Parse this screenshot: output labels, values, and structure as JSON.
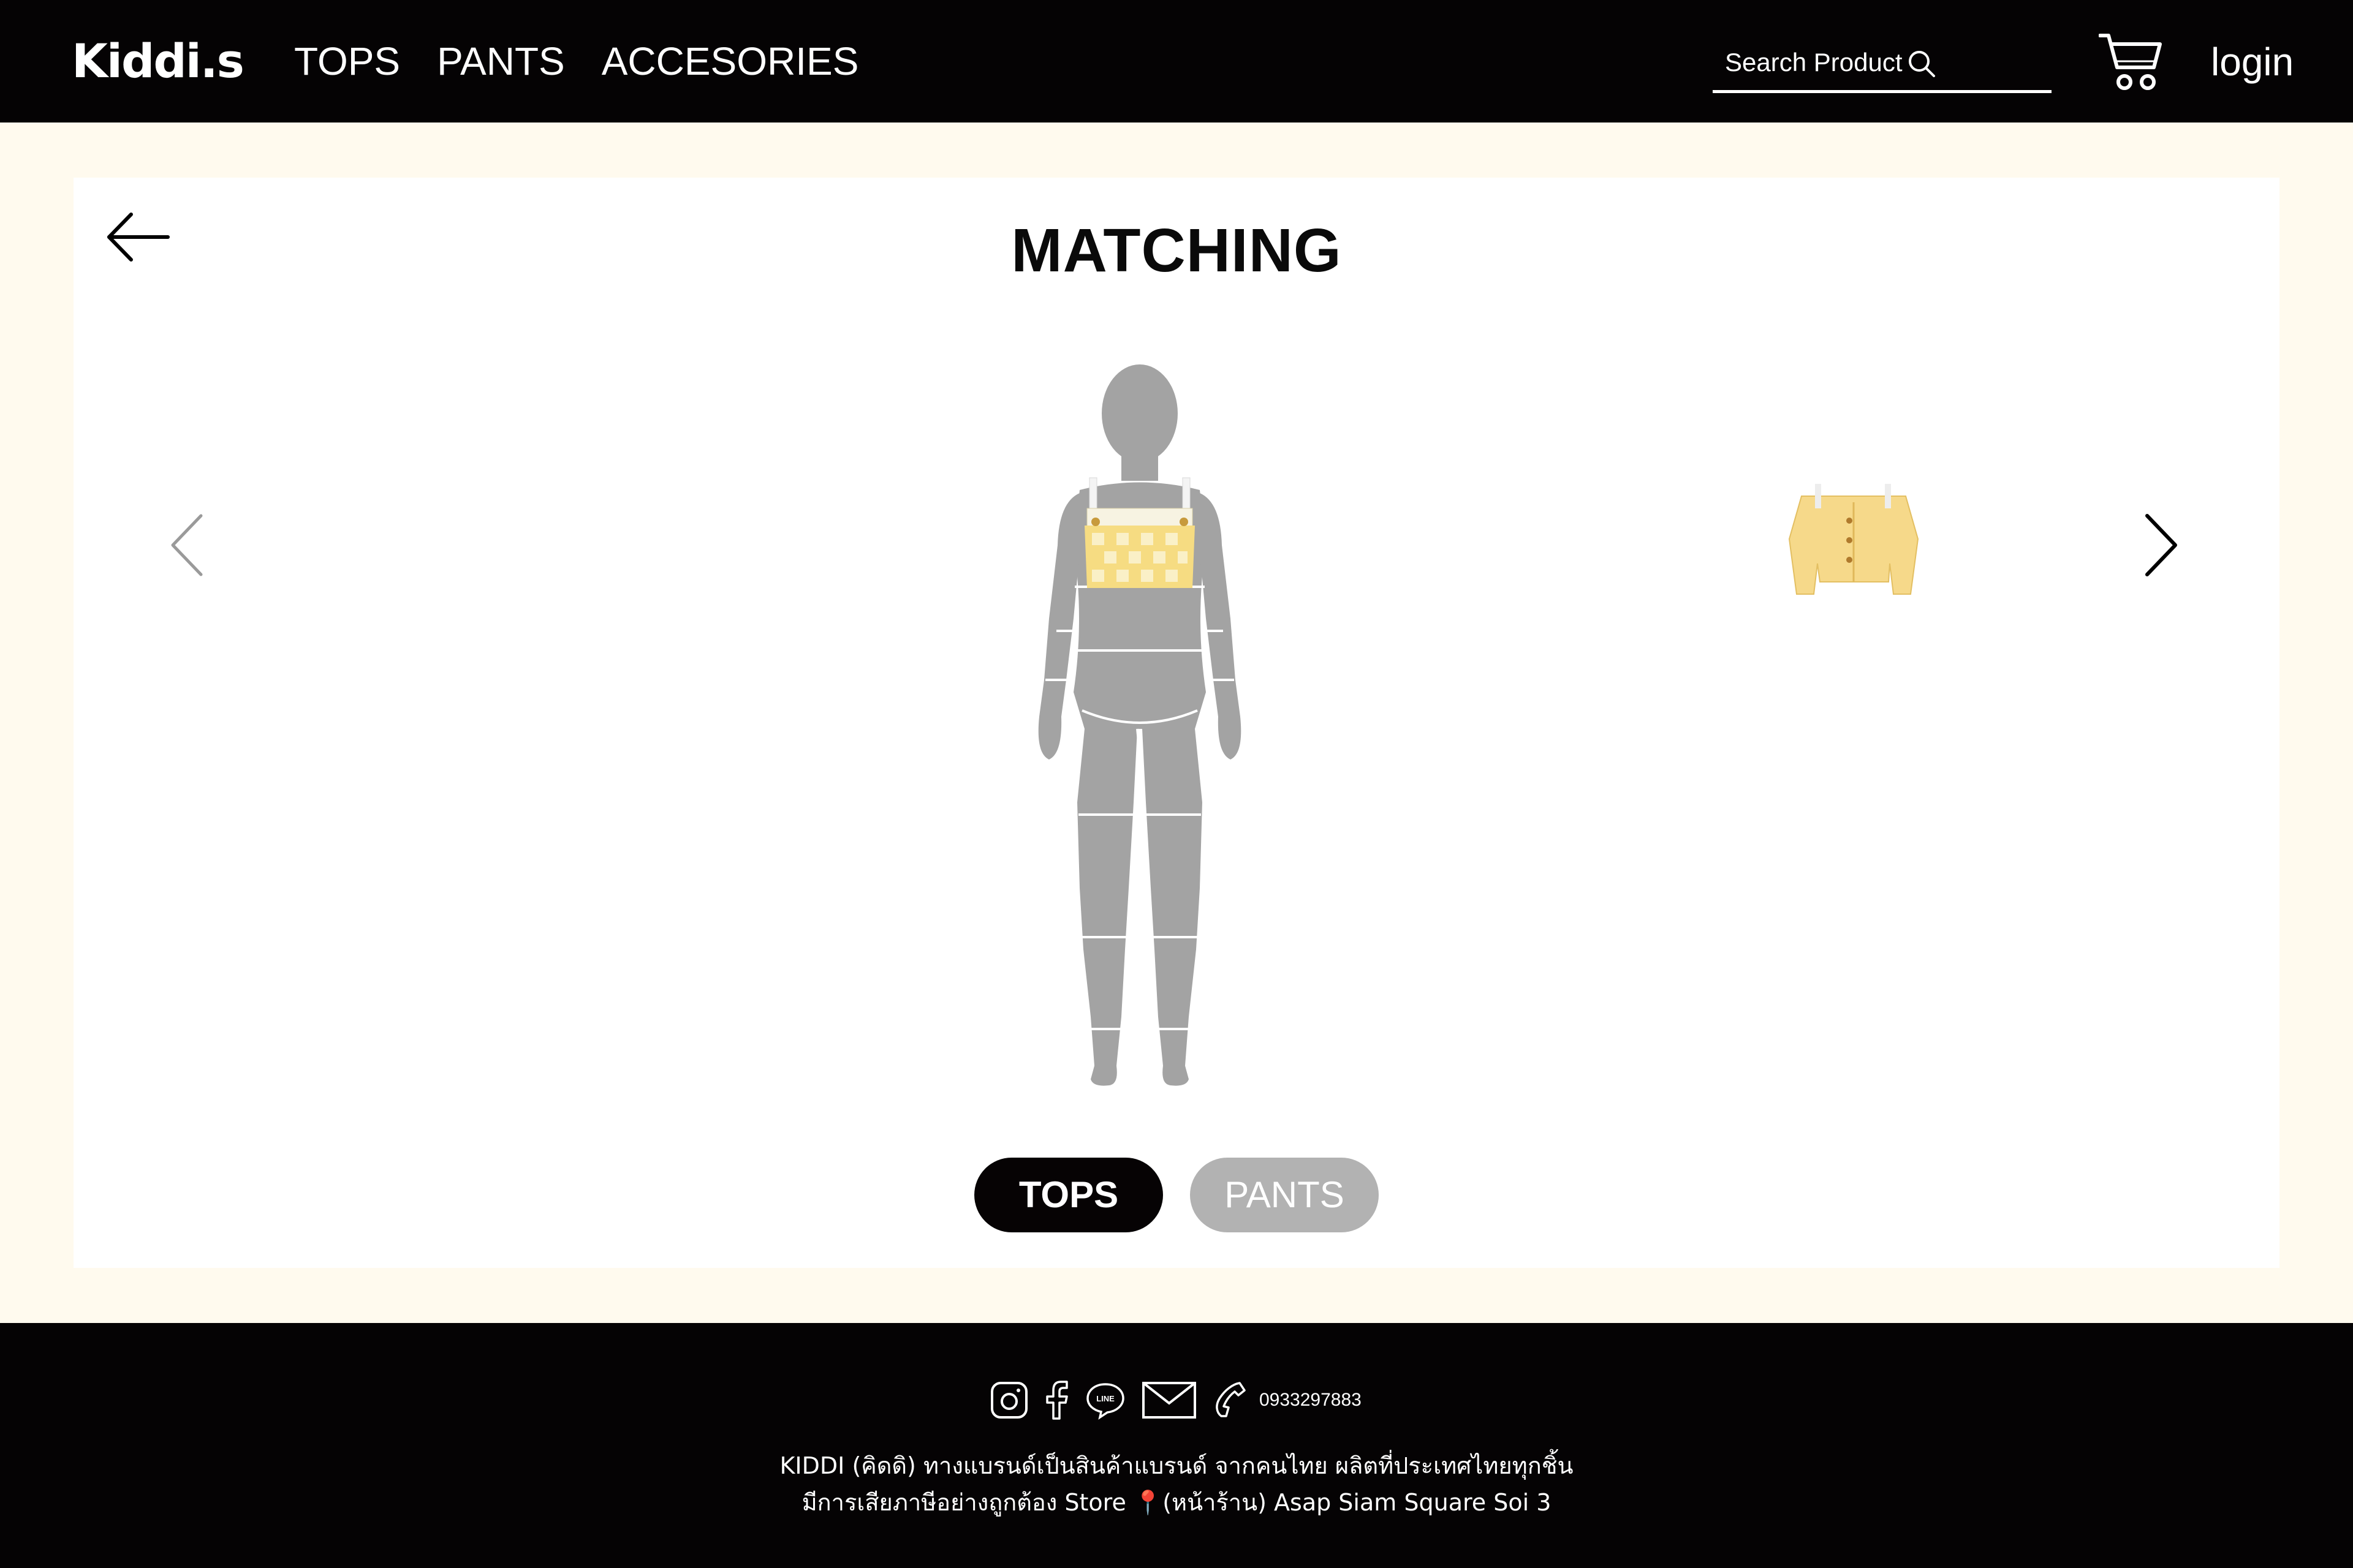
{
  "header": {
    "logo": "Kiddi.s",
    "nav": [
      "TOPS",
      "PANTS",
      "ACCESORIES"
    ],
    "search_label": "Search Product",
    "login_label": "login"
  },
  "main": {
    "title": "MATCHING",
    "toggle": {
      "tops_label": "TOPS",
      "pants_label": "PANTS",
      "active": "TOPS"
    }
  },
  "footer": {
    "phone": "0933297883",
    "line1": "KIDDI (คิดดิ) ทางแบรนด์เป็นสินค้าแบรนด์ จากคนไทย ผลิตที่ประเทศไทยทุกชิ้น",
    "line2": "มีการเสียภาษีอย่างถูกต้อง Store 📍(หน้าร้าน) Asap Siam Square Soi 3"
  },
  "colors": {
    "header_bg": "#050304",
    "page_bg": "#fffaee",
    "mannequin": "#a3a3a3",
    "inactive_toggle": "#b2b2b2",
    "garment_yellow": "#f6dc82"
  },
  "icons": [
    "back-arrow-icon",
    "chevron-left-icon",
    "chevron-right-icon",
    "search-icon",
    "cart-icon",
    "instagram-icon",
    "facebook-icon",
    "line-icon",
    "mail-icon",
    "phone-icon"
  ]
}
